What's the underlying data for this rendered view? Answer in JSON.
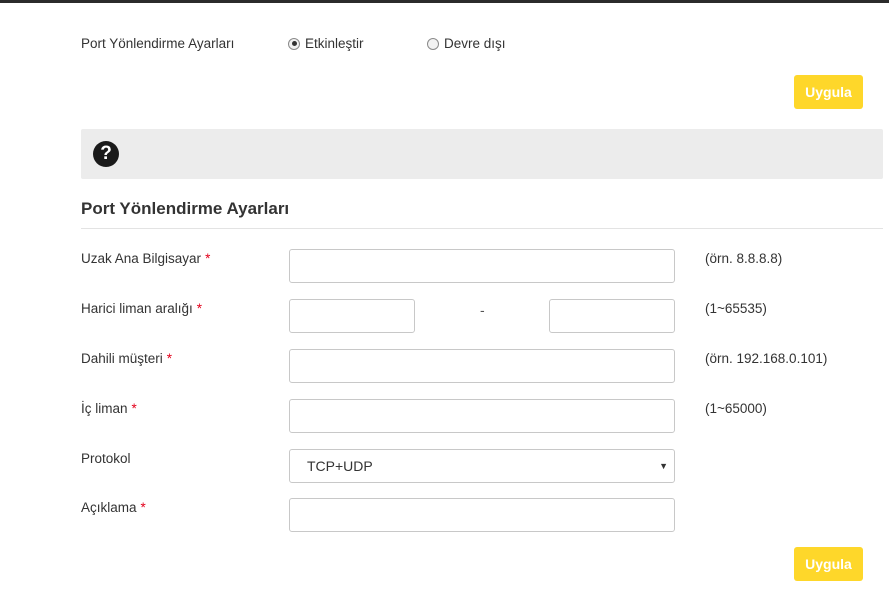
{
  "status": {
    "label": "Port Yönlendirme Ayarları",
    "options": [
      "Etkinleştir",
      "Devre dışı"
    ],
    "selected": 0
  },
  "apply_label": "Uygula",
  "help_icon_glyph": "?",
  "section_title": "Port Yönlendirme Ayarları",
  "fields": {
    "remote_host": {
      "label": "Uzak Ana Bilgisayar",
      "required": "*",
      "value": "",
      "hint": "(örn. 8.8.8.8)"
    },
    "external_range": {
      "label": "Harici liman aralığı",
      "required": "*",
      "start": "",
      "end": "",
      "separator": "-",
      "hint": "(1~65535)"
    },
    "internal_client": {
      "label": "Dahili müşteri",
      "required": "*",
      "value": "",
      "hint": "(örn. 192.168.0.101)"
    },
    "internal_port": {
      "label": "İç liman",
      "required": "*",
      "value": "",
      "hint": "(1~65000)"
    },
    "protocol": {
      "label": "Protokol",
      "value": "TCP+UDP"
    },
    "description": {
      "label": "Açıklama",
      "required": "*",
      "value": ""
    }
  },
  "colors": {
    "accent": "#fed72a",
    "required": "#e3001b",
    "top_bar": "#2b2b2b"
  }
}
